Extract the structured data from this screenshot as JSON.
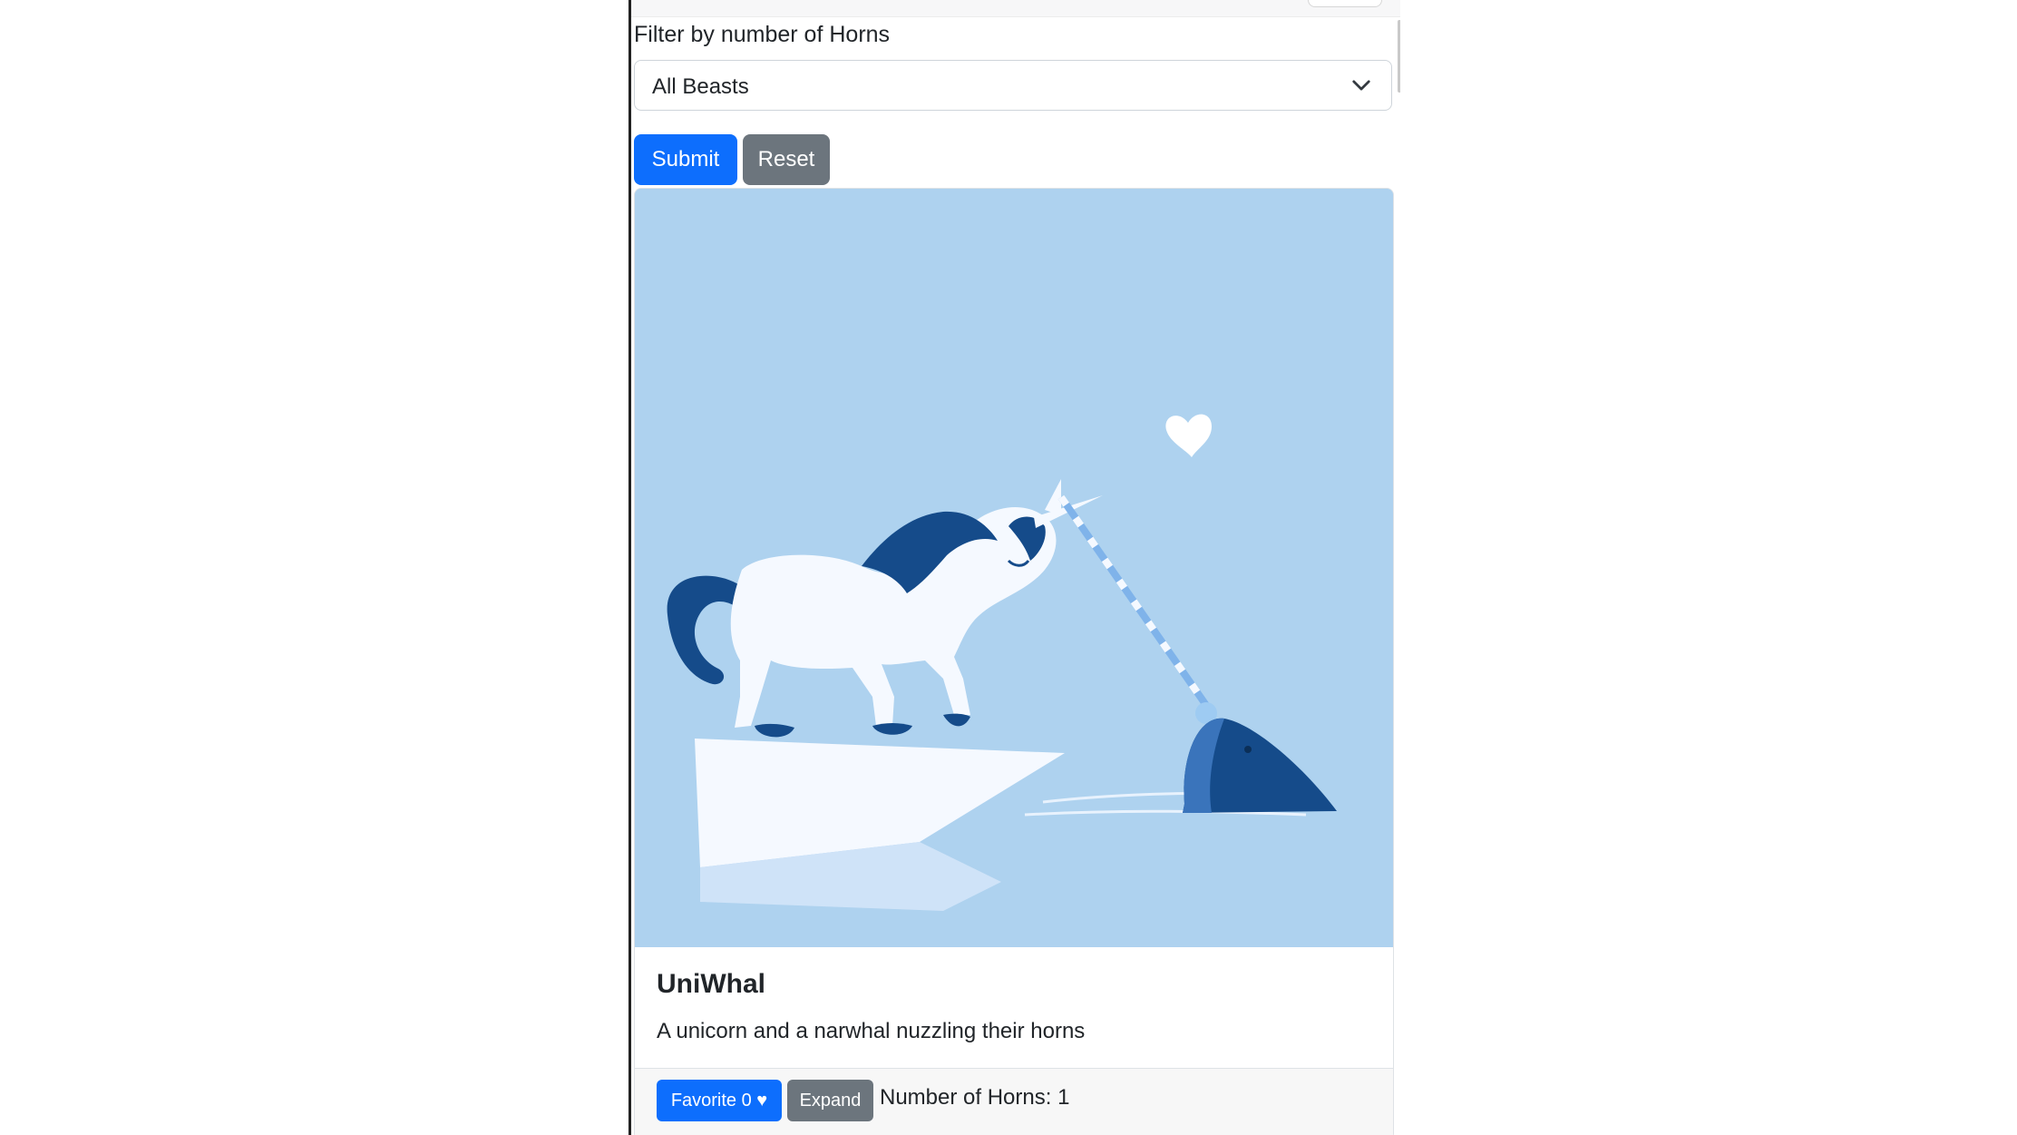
{
  "filter": {
    "label": "Filter by number of Horns",
    "selected": "All Beasts"
  },
  "buttons": {
    "submit": "Submit",
    "reset": "Reset"
  },
  "card": {
    "title": "UniWhal",
    "description": "A unicorn and a narwhal nuzzling their horns",
    "favorite_label": "Favorite 0 ♥",
    "expand_label": "Expand",
    "horns_text": "Number of Horns: 1"
  },
  "colors": {
    "primary": "#0d6efd",
    "secondary": "#6c757d",
    "image_bg": "#aed2ef"
  }
}
